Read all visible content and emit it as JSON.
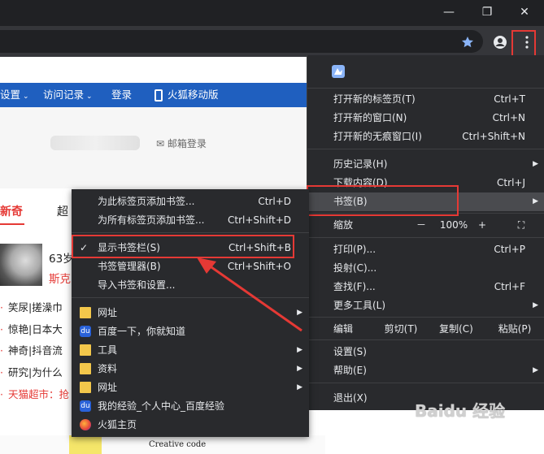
{
  "browser": {
    "window_controls": {
      "minimize": "—",
      "restore": "❐",
      "close": "✕"
    }
  },
  "page": {
    "top_nav": [
      {
        "label": "设置",
        "caret": "⌄"
      },
      {
        "label": "访问记录",
        "caret": "⌄"
      },
      {
        "label": "登录"
      },
      {
        "label": "火狐移动版"
      }
    ],
    "mail_login": "✉ 邮箱登录",
    "news_tabs": [
      "新奇",
      "超"
    ],
    "headline_1": "63岁",
    "headline_2": "斯克",
    "news_items": [
      "笑尿|搓澡巾",
      "惊艳|日本大",
      "神奇|抖音流",
      "研究|为什么",
      "天猫超市：抢"
    ],
    "creative_code": "Creative code"
  },
  "chrome_menu": {
    "items": {
      "new_tab": {
        "label": "打开新的标签页(T)",
        "shortcut": "Ctrl+T"
      },
      "new_window": {
        "label": "打开新的窗口(N)",
        "shortcut": "Ctrl+N"
      },
      "incognito": {
        "label": "打开新的无痕窗口(I)",
        "shortcut": "Ctrl+Shift+N"
      },
      "history": {
        "label": "历史记录(H)"
      },
      "downloads": {
        "label": "下载内容(D)",
        "shortcut": "Ctrl+J"
      },
      "bookmarks": {
        "label": "书签(B)"
      },
      "zoom": {
        "label": "缩放",
        "minus": "－",
        "value": "100%",
        "plus": "+",
        "fullscreen": "⛶"
      },
      "print": {
        "label": "打印(P)...",
        "shortcut": "Ctrl+P"
      },
      "cast": {
        "label": "投射(C)..."
      },
      "find": {
        "label": "查找(F)...",
        "shortcut": "Ctrl+F"
      },
      "more_tools": {
        "label": "更多工具(L)"
      },
      "edit": {
        "label": "编辑",
        "cut": "剪切(T)",
        "copy": "复制(C)",
        "paste": "粘贴(P)"
      },
      "settings": {
        "label": "设置(S)"
      },
      "help": {
        "label": "帮助(E)"
      },
      "exit": {
        "label": "退出(X)"
      }
    }
  },
  "bookmarks_submenu": {
    "actions": [
      {
        "label": "为此标签页添加书签...",
        "shortcut": "Ctrl+D"
      },
      {
        "label": "为所有标签页添加书签...",
        "shortcut": "Ctrl+Shift+D"
      }
    ],
    "show_bar": {
      "check": "✓",
      "label": "显示书签栏(S)",
      "shortcut": "Ctrl+Shift+B"
    },
    "manager": {
      "label": "书签管理器(B)",
      "shortcut": "Ctrl+Shift+O"
    },
    "import": {
      "label": "导入书签和设置..."
    },
    "entries": [
      {
        "label": "网址",
        "icon": "folder-icon"
      },
      {
        "label": "百度一下，你就知道",
        "icon": "baidu-icon"
      },
      {
        "label": "工具",
        "icon": "folder-icon"
      },
      {
        "label": "资料",
        "icon": "folder-icon"
      },
      {
        "label": "网址",
        "icon": "folder-icon"
      },
      {
        "label": "我的经验_个人中心_百度经验",
        "icon": "baidu-icon"
      },
      {
        "label": "火狐主页",
        "icon": "firefox-icon"
      }
    ]
  },
  "watermark": "Baidu 经验",
  "colors": {
    "highlight": "#e53935",
    "menu_bg": "#292a2d",
    "nav_blue": "#1f5fbf"
  }
}
